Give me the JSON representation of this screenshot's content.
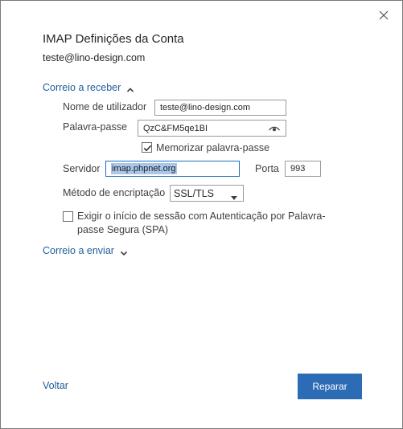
{
  "dialog": {
    "title": "IMAP Definições da Conta",
    "account_email": "teste@lino-design.com"
  },
  "incoming": {
    "section_label": "Correio a receber",
    "username_label": "Nome de utilizador",
    "username_value": "teste@lino-design.com",
    "password_label": "Palavra-passe",
    "password_value": "QzC&FM5qe1BI",
    "remember_password_label": "Memorizar palavra-passe",
    "remember_password_checked": true,
    "server_label": "Servidor",
    "server_value": "imap.phpnet.org",
    "port_label": "Porta",
    "port_value": "993",
    "encryption_label": "Método de encriptação",
    "encryption_value": "SSL/TLS",
    "spa_label_line1": "Exigir o início de sessão com Autenticação por Palavra-",
    "spa_label_line2": "passe Segura (SPA)",
    "spa_checked": false
  },
  "outgoing": {
    "section_label": "Correio a enviar"
  },
  "footer": {
    "back_label": "Voltar",
    "repair_label": "Reparar"
  },
  "colors": {
    "link": "#1f5d9e",
    "primary_button": "#2b6cb5",
    "selection": "#a9c7ea",
    "focus_border": "#1a6ec2"
  },
  "icons": {
    "close": "close-icon",
    "expand_up": "chevron-up-icon",
    "expand_down": "chevron-down-icon",
    "show_password": "eye-icon",
    "dropdown": "chevron-down-icon",
    "check": "checkmark-icon"
  }
}
